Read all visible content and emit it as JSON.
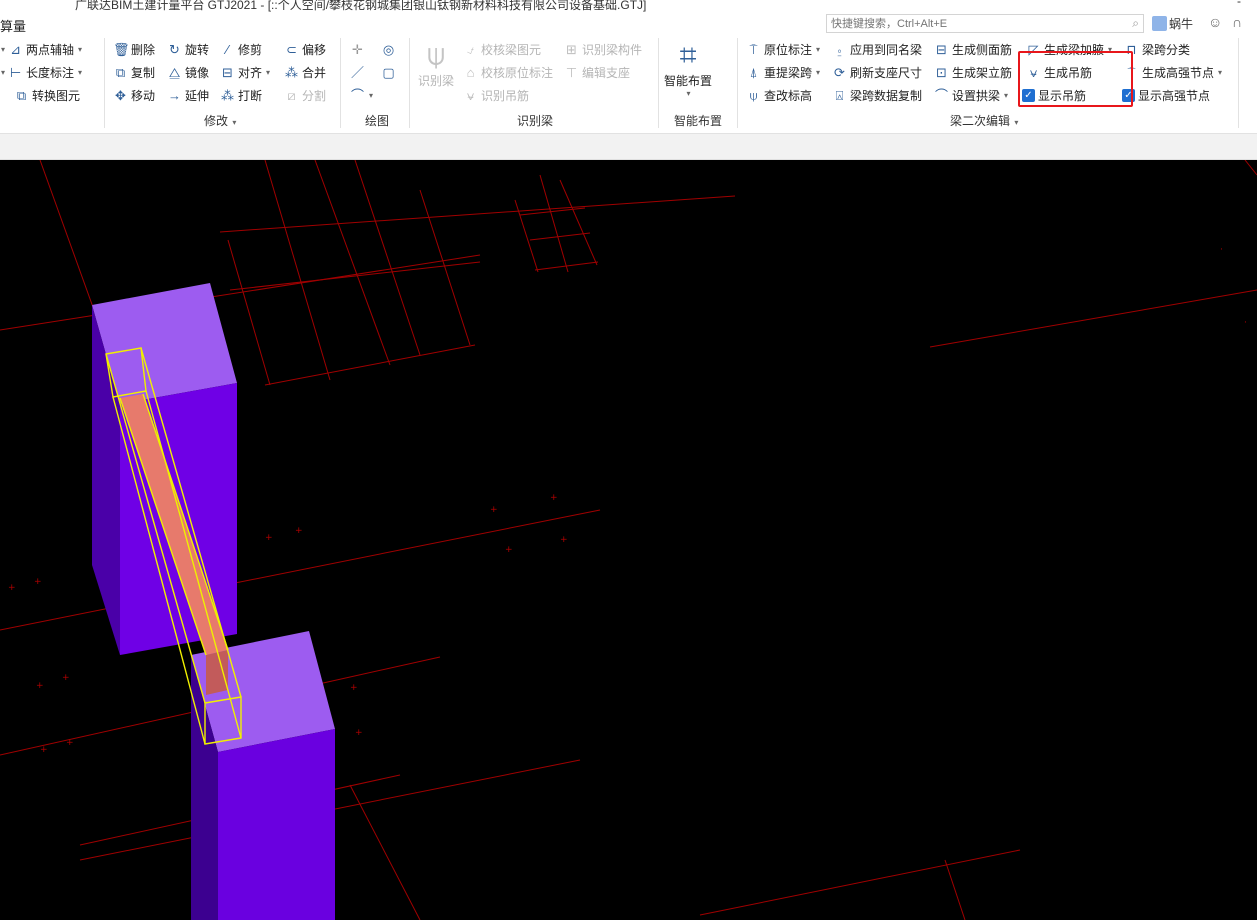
{
  "window": {
    "title": "广联达BIM土建计量平台 GTJ2021 - [::个人空间/攀枝花钢城集团银山钛钢新材料科技有限公司设备基础.GTJ]",
    "menu_label": "算量",
    "minimize": "-"
  },
  "search": {
    "placeholder": "快捷键搜索，Ctrl+Alt+E"
  },
  "user": {
    "name": "蜗牛"
  },
  "ribbon": {
    "groups": {
      "modify": "修改",
      "draw": "绘图",
      "identify_beam": "识别梁",
      "smart_layout": "智能布置",
      "beam_edit": "梁二次编辑"
    },
    "left_items": {
      "two_point_axis": "两点辅轴",
      "length_mark": "长度标注",
      "convert_elem": "转换图元"
    },
    "modify_items": {
      "delete": "删除",
      "rotate": "旋转",
      "trim": "修剪",
      "offset": "偏移",
      "copy": "复制",
      "mirror": "镜像",
      "align": "对齐",
      "merge": "合并",
      "move": "移动",
      "extend": "延伸",
      "break": "打断",
      "split": "分割"
    },
    "identify_items": {
      "identify_beam": "识别梁",
      "check_beam": "校核梁图元",
      "identify_component": "识别梁构件",
      "check_origin_mark": "校核原位标注",
      "edit_support": "编辑支座",
      "identify_hanger": "识别吊筋"
    },
    "smart_layout_button": "智能布置",
    "beam_edit_items": {
      "origin_mark": "原位标注",
      "apply_same_name": "应用到同名梁",
      "gen_side_bar": "生成侧面筋",
      "gen_haunch": "生成梁加腋",
      "span_classify": "梁跨分类",
      "re_span": "重提梁跨",
      "refresh_support": "刷新支座尺寸",
      "gen_erect_bar": "生成架立筋",
      "gen_hanger": "生成吊筋",
      "gen_strong_node": "生成高强节点",
      "check_elevation": "查改标高",
      "span_data_copy": "梁跨数据复制",
      "set_arch_beam": "设置拱梁",
      "show_hanger": "显示吊筋",
      "show_strong_node": "显示高强节点"
    },
    "checkbox_state": {
      "show_hanger": true,
      "show_strong_node": true
    }
  },
  "colors": {
    "ribbon_icon": "#2f5f98",
    "highlight_box": "#e8161b",
    "column_face": "#6f00e6",
    "beam_fill": "#e77a6c",
    "selection_outline": "#f0f000",
    "grid_line": "#a00000",
    "viewport_bg": "#000000"
  }
}
